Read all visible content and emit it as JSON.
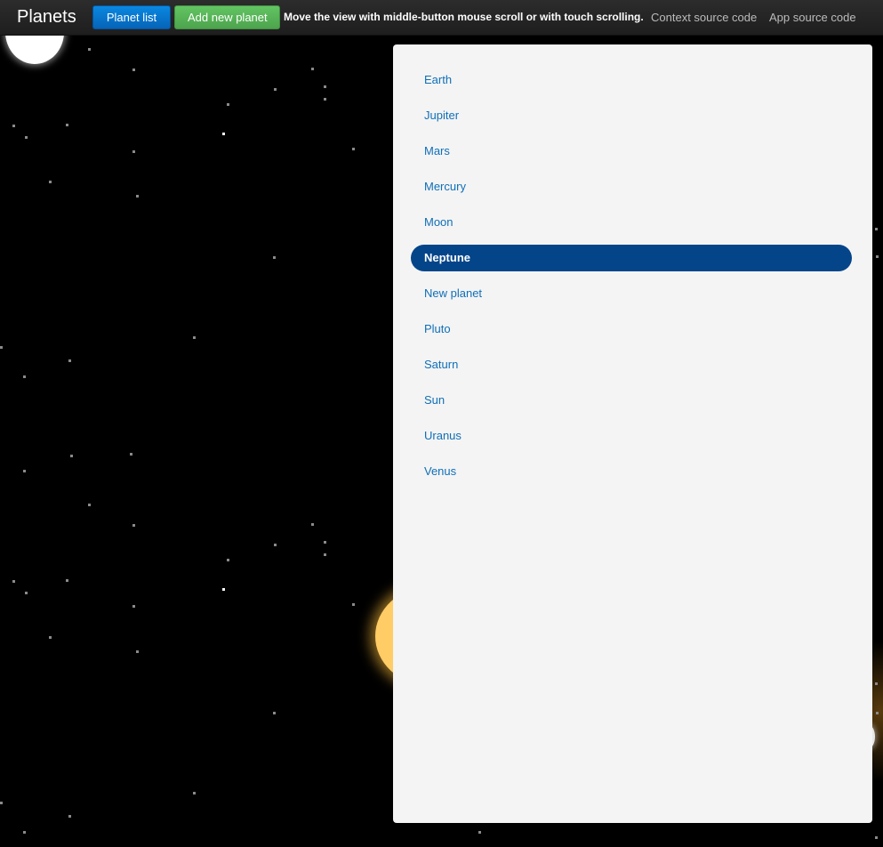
{
  "navbar": {
    "brand": "Planets",
    "planet_list_button": "Planet list",
    "add_planet_button": "Add new planet",
    "hint": "Move the view with middle-button mouse scroll or with touch scrolling.",
    "context_source_link": "Context source code",
    "app_source_link": "App source code"
  },
  "colors": {
    "primary_button": "#0a7bd4",
    "success_button": "#5cb85c",
    "active_item_bg": "#04458a",
    "link_text": "#0f6fb8",
    "panel_bg": "#f4f4f4"
  },
  "planet_list": {
    "items": [
      {
        "label": "Earth",
        "active": false
      },
      {
        "label": "Jupiter",
        "active": false
      },
      {
        "label": "Mars",
        "active": false
      },
      {
        "label": "Mercury",
        "active": false
      },
      {
        "label": "Moon",
        "active": false
      },
      {
        "label": "Neptune",
        "active": true
      },
      {
        "label": "New planet",
        "active": false
      },
      {
        "label": "Pluto",
        "active": false
      },
      {
        "label": "Saturn",
        "active": false
      },
      {
        "label": "Sun",
        "active": false
      },
      {
        "label": "Uranus",
        "active": false
      },
      {
        "label": "Venus",
        "active": false
      }
    ]
  }
}
